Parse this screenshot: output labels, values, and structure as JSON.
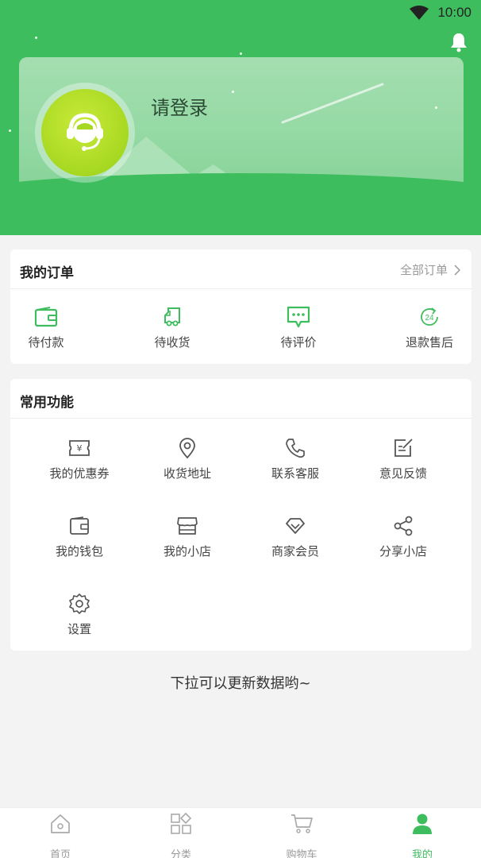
{
  "status_bar": {
    "time": "10:00"
  },
  "profile": {
    "login_prompt": "请登录"
  },
  "orders": {
    "title": "我的订单",
    "all_orders_link": "全部订单",
    "items": [
      {
        "label": "待付款",
        "icon": "wallet-icon"
      },
      {
        "label": "待收货",
        "icon": "delivery-truck-icon"
      },
      {
        "label": "待评价",
        "icon": "comment-icon"
      },
      {
        "label": "退款售后",
        "icon": "refund-24-icon"
      }
    ]
  },
  "functions": {
    "title": "常用功能",
    "items": [
      {
        "label": "我的优惠券",
        "icon": "coupon-icon"
      },
      {
        "label": "收货地址",
        "icon": "location-pin-icon"
      },
      {
        "label": "联系客服",
        "icon": "phone-icon"
      },
      {
        "label": "意见反馈",
        "icon": "feedback-edit-icon"
      },
      {
        "label": "我的钱包",
        "icon": "wallet-icon"
      },
      {
        "label": "我的小店",
        "icon": "store-icon"
      },
      {
        "label": "商家会员",
        "icon": "diamond-icon"
      },
      {
        "label": "分享小店",
        "icon": "share-icon"
      },
      {
        "label": "设置",
        "icon": "gear-icon"
      }
    ]
  },
  "pull_hint": "下拉可以更新数据哟~",
  "tabbar": {
    "items": [
      {
        "label": "首页",
        "icon": "home-icon"
      },
      {
        "label": "分类",
        "icon": "category-grid-icon"
      },
      {
        "label": "购物车",
        "icon": "cart-icon"
      },
      {
        "label": "我的",
        "icon": "user-icon",
        "active": true
      }
    ]
  },
  "colors": {
    "brand_green": "#3ebd5f",
    "avatar_lime": "#a7d821"
  }
}
